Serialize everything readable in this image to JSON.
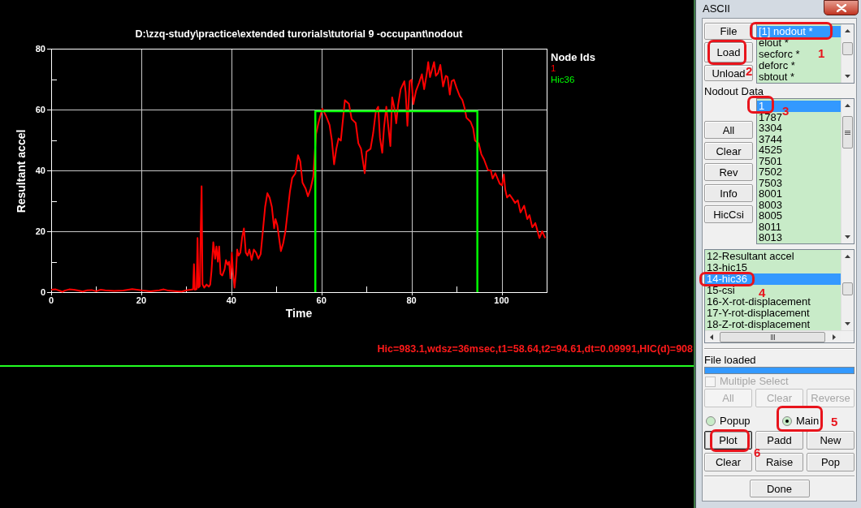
{
  "plot": {
    "chart_data": {
      "type": "line",
      "title": "D:\\zzq-study\\practice\\extended turorials\\tutorial 9 -occupant\\nodout",
      "xlabel": "Time",
      "ylabel": "Resultant accel",
      "xlim": [
        0,
        110
      ],
      "ylim": [
        0,
        80
      ],
      "xticks": [
        0,
        20,
        40,
        60,
        80,
        100
      ],
      "yticks": [
        0,
        20,
        40,
        60,
        80
      ],
      "grid": true,
      "legend_title": "Node Ids",
      "series": [
        {
          "name": "1",
          "color": "#ff0000",
          "x": [
            0,
            1,
            2,
            2.5,
            3,
            4,
            5,
            6,
            7,
            8,
            9,
            10,
            11,
            12,
            14,
            16,
            18,
            19,
            20,
            22,
            24,
            25,
            26,
            28,
            29,
            30,
            31,
            31.5,
            31.7,
            31.9,
            32.3,
            32.5,
            32.7,
            33,
            33.2,
            33.4,
            33.6,
            34,
            34.5,
            35,
            35.3,
            35.6,
            36,
            36.4,
            36.7,
            37,
            37.3,
            37.6,
            38,
            38.5,
            38.8,
            39.2,
            39.5,
            39.8,
            40.1,
            40.4,
            40.7,
            41,
            41.3,
            41.6,
            42,
            42.4,
            42.8,
            43.2,
            43.6,
            44,
            44.5,
            45,
            45.5,
            46,
            46.5,
            47,
            47.5,
            48,
            48.5,
            49,
            49.5,
            49.8,
            50.2,
            51,
            51.5,
            52,
            53,
            53.5,
            54.2,
            54.8,
            55.3,
            55.8,
            56.5,
            57,
            57.6,
            58.2,
            58.5,
            58.8,
            59.4,
            60.2,
            61,
            61.8,
            62.3,
            62.8,
            63.3,
            63.8,
            64.3,
            65.2,
            66.1,
            66.7,
            67.6,
            68.2,
            68.8,
            69.6,
            70,
            70.9,
            71.5,
            72.1,
            72.6,
            73,
            73.5,
            73.9,
            74.4,
            74.8,
            75.3,
            75.7,
            76.2,
            76.6,
            77,
            77.6,
            78.4,
            78.7,
            79.1,
            79.6,
            80,
            80.4,
            81,
            81.7,
            82.3,
            82.8,
            83.4,
            83.7,
            84.1,
            85,
            85.4,
            85.9,
            86.4,
            87,
            87.6,
            88,
            88.5,
            88.9,
            89.4,
            90,
            90.7,
            91.3,
            91.8,
            92.2,
            93.1,
            93.7,
            94.1,
            94.9,
            95.5,
            96.1,
            97,
            97.6,
            98,
            98.6,
            99.1,
            99.6,
            100.1,
            100.5,
            100.8,
            101.2,
            101.8,
            102.4,
            103,
            103.6,
            104.2,
            105,
            105.7,
            106.2,
            106.8,
            107.5,
            108.4,
            109,
            109.7
          ],
          "values": [
            0.8,
            0.9,
            0.4,
            0.1,
            0.5,
            0.9,
            0.8,
            0.5,
            0.2,
            0.6,
            0.7,
            0.3,
            0.8,
            0.6,
            0.4,
            0.5,
            1.0,
            0.8,
            0.6,
            0.3,
            0.6,
            0.9,
            0.5,
            0.3,
            0.2,
            0.6,
            0.8,
            0.9,
            9.2,
            0.8,
            1.0,
            17.8,
            1.5,
            2.0,
            20.4,
            34.8,
            2.5,
            1.5,
            2.5,
            1.8,
            2.5,
            7.0,
            16.4,
            11.0,
            15.0,
            10.0,
            15.0,
            6.0,
            5.5,
            7.5,
            10.5,
            9.0,
            10.0,
            4.5,
            12.9,
            6.0,
            1.5,
            6.0,
            14.0,
            12.0,
            13.0,
            18.0,
            20.9,
            13.0,
            12.0,
            14.0,
            10.5,
            14.0,
            13.0,
            11.0,
            12.5,
            20.0,
            28.0,
            32.5,
            31.0,
            28.0,
            21.0,
            24.0,
            22.0,
            13.5,
            16.0,
            20.0,
            33.0,
            37.5,
            39.0,
            45.0,
            43.0,
            36.0,
            34.0,
            31.5,
            34.0,
            38.0,
            45.0,
            52.0,
            56.0,
            60.3,
            58.0,
            55.0,
            50.0,
            42.0,
            47.0,
            50.5,
            49.8,
            63.1,
            61.9,
            56.9,
            55.6,
            48.9,
            47.1,
            39.1,
            46.2,
            47.1,
            52.4,
            59.6,
            60.9,
            50.7,
            45.8,
            54.2,
            60.9,
            55.1,
            48.0,
            64.0,
            60.4,
            55.5,
            61.3,
            66.7,
            69.3,
            65.8,
            54.7,
            69.3,
            69.8,
            61.8,
            66.2,
            68.9,
            71.6,
            66.7,
            72.0,
            75.6,
            70.7,
            75.6,
            71.1,
            72.0,
            74.7,
            67.6,
            71.1,
            70.7,
            64.9,
            69.3,
            69.8,
            67.1,
            64.4,
            63.1,
            60.4,
            57.3,
            56.0,
            53.8,
            49.8,
            48.9,
            45.3,
            43.6,
            40.0,
            40.0,
            37.3,
            39.1,
            37.3,
            35.6,
            35.1,
            38.7,
            33.8,
            31.1,
            32.0,
            30.7,
            29.3,
            30.2,
            26.2,
            28.4,
            24.0,
            25.3,
            21.3,
            22.7,
            17.8,
            20.0,
            17.8
          ]
        },
        {
          "name": "Hic36",
          "color": "#00ff00",
          "x": [
            58.64,
            58.64,
            94.61,
            94.61
          ],
          "values": [
            0,
            59.5,
            59.5,
            0
          ]
        }
      ]
    },
    "hic_result": "Hic=983.1,wdsz=36msec,t1=58.64,t2=94.61,dt=0.09991,HIC(d)=908"
  },
  "ascii_window": {
    "title": "ASCII",
    "file_buttons": [
      "File",
      "Load",
      "Unload"
    ],
    "file_list": [
      {
        "label": "[1] nodout *",
        "selected": true
      },
      {
        "label": "elout *",
        "selected": false
      },
      {
        "label": "secforc *",
        "selected": false
      },
      {
        "label": "deforc *",
        "selected": false
      },
      {
        "label": "sbtout *",
        "selected": false
      }
    ],
    "nodout_label": "Nodout Data",
    "node_buttons": [
      "All",
      "Clear",
      "Rev",
      "Info",
      "HicCsi"
    ],
    "node_list": [
      {
        "label": "1",
        "selected": true
      },
      {
        "label": "1787",
        "selected": false
      },
      {
        "label": "3304",
        "selected": false
      },
      {
        "label": "3744",
        "selected": false
      },
      {
        "label": "4525",
        "selected": false
      },
      {
        "label": "7501",
        "selected": false
      },
      {
        "label": "7502",
        "selected": false
      },
      {
        "label": "7503",
        "selected": false
      },
      {
        "label": "8001",
        "selected": false
      },
      {
        "label": "8003",
        "selected": false
      },
      {
        "label": "8005",
        "selected": false
      },
      {
        "label": "8011",
        "selected": false
      },
      {
        "label": "8013",
        "selected": false
      }
    ],
    "component_list": [
      {
        "label": "12-Resultant accel",
        "selected": false
      },
      {
        "label": "13-hic15",
        "selected": false
      },
      {
        "label": "14-hic36",
        "selected": true
      },
      {
        "label": "15-csi",
        "selected": false
      },
      {
        "label": "16-X-rot-displacement",
        "selected": false
      },
      {
        "label": "17-Y-rot-displacement",
        "selected": false
      },
      {
        "label": "18-Z-rot-displacement",
        "selected": false
      }
    ],
    "file_loaded_label": "File loaded",
    "file_loaded_list": [
      {
        "selected": true
      }
    ],
    "multiple_select": {
      "label": "Multiple Select",
      "checked": false,
      "disabled": true
    },
    "select_buttons": [
      {
        "label": "All",
        "disabled": true
      },
      {
        "label": "Clear",
        "disabled": true
      },
      {
        "label": "Reverse",
        "disabled": true
      }
    ],
    "plot_target": [
      {
        "label": "Popup",
        "selected": false
      },
      {
        "label": "Main",
        "selected": true
      }
    ],
    "plot_buttons": [
      {
        "label": "Plot",
        "focused": true
      },
      {
        "label": "Padd",
        "focused": false
      },
      {
        "label": "New",
        "focused": false
      },
      {
        "label": "Clear",
        "focused": false
      },
      {
        "label": "Raise",
        "focused": false
      },
      {
        "label": "Pop",
        "focused": false
      }
    ],
    "done_button": "Done"
  },
  "annotations": [
    {
      "number": "1"
    },
    {
      "number": "2"
    },
    {
      "number": "3"
    },
    {
      "number": "4"
    },
    {
      "number": "5"
    },
    {
      "number": "6"
    }
  ]
}
